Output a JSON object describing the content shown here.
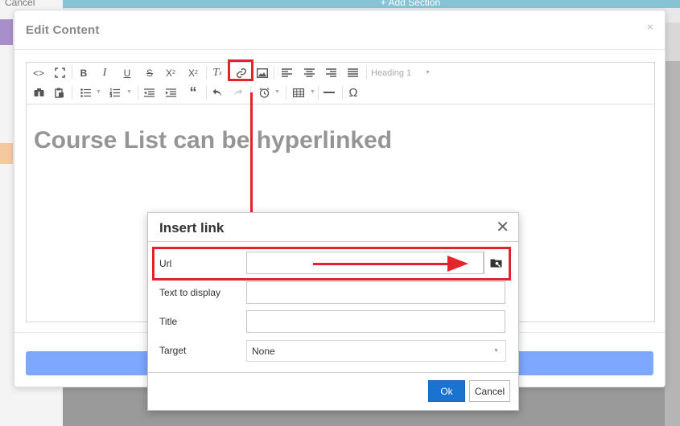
{
  "background": {
    "cancel_label": "Cancel",
    "add_section_label": "+ Add Section"
  },
  "edit_modal": {
    "title": "Edit Content",
    "close_glyph": "×"
  },
  "toolbar": {
    "heading_select": "Heading 1",
    "icons": [
      "source-code-icon",
      "fullscreen-icon",
      "bold-icon",
      "italic-icon",
      "underline-icon",
      "strikethrough-icon",
      "subscript-icon",
      "superscript-icon",
      "clear-format-icon",
      "link-icon",
      "image-icon",
      "align-left-icon",
      "align-center-icon",
      "align-right-icon",
      "align-justify-icon",
      "find-replace-icon",
      "paste-text-icon",
      "bullet-list-icon",
      "numbered-list-icon",
      "outdent-icon",
      "indent-icon",
      "blockquote-icon",
      "undo-icon",
      "redo-icon",
      "insert-time-icon",
      "table-icon",
      "horizontal-rule-icon",
      "special-char-icon"
    ]
  },
  "editor": {
    "content": "Course List can be hyperlinked"
  },
  "insert_link": {
    "title": "Insert link",
    "close_glyph": "✕",
    "url_label": "Url",
    "url_value": "",
    "text_label": "Text to display",
    "text_value": "",
    "title_label": "Title",
    "title_value": "",
    "target_label": "Target",
    "target_value": "None",
    "ok_label": "Ok",
    "cancel_label": "Cancel"
  },
  "colors": {
    "annotation": "#e4232b",
    "ok_button": "#1a73d0",
    "save_bar": "#7ea7ff"
  }
}
